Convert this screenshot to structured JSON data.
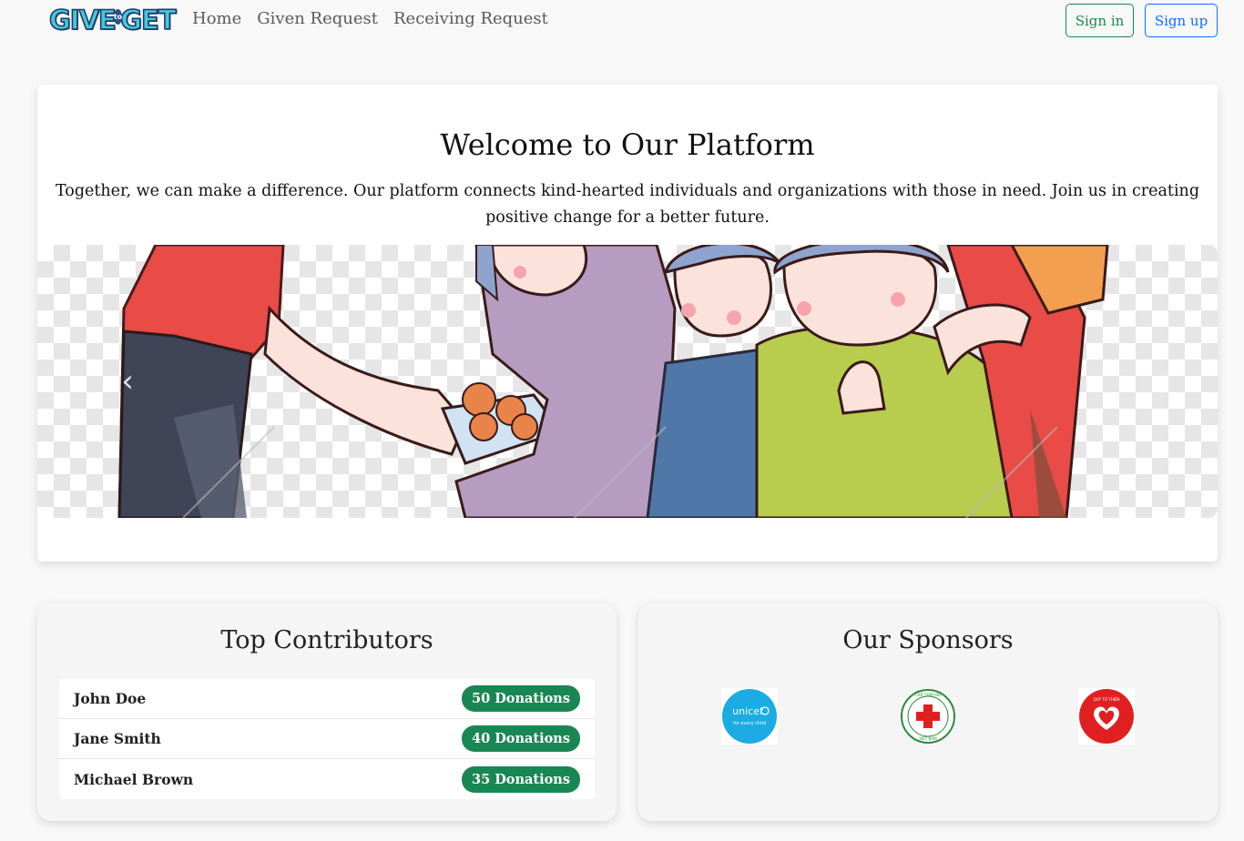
{
  "brand": {
    "part1": "GIVE",
    "to": "to",
    "part2": "GET"
  },
  "nav": {
    "links": [
      "Home",
      "Given Request",
      "Receiving Request"
    ],
    "sign_in": "Sign in",
    "sign_up": "Sign up"
  },
  "hero": {
    "title": "Welcome to Our Platform",
    "text": "Together, we can make a difference. Our platform connects kind-hearted individuals and organizations with those in need. Join us in creating positive change for a better future.",
    "prev_icon": "chevron-left-icon",
    "next_icon": "chevron-right-icon"
  },
  "contributors": {
    "title": "Top Contributors",
    "items": [
      {
        "name": "John Doe",
        "donations": "50 Donations"
      },
      {
        "name": "Jane Smith",
        "donations": "40 Donations"
      },
      {
        "name": "Michael Brown",
        "donations": "35 Donations"
      }
    ]
  },
  "sponsors": {
    "title": "Our Sponsors",
    "logos": [
      {
        "name": "unicef-logo",
        "text": "unicef",
        "sub": "for every child",
        "color": "#1cabe2"
      },
      {
        "name": "red-cross-logo",
        "text": "CHỮ THẬP ĐỎ",
        "sub": "VIỆT NAM",
        "color": "#e02020"
      },
      {
        "name": "charity-heart-logo",
        "text": "QUỸ TỪ THIỆN",
        "color": "#e02020"
      }
    ]
  },
  "colors": {
    "success": "#198754",
    "primary": "#0d6efd"
  }
}
